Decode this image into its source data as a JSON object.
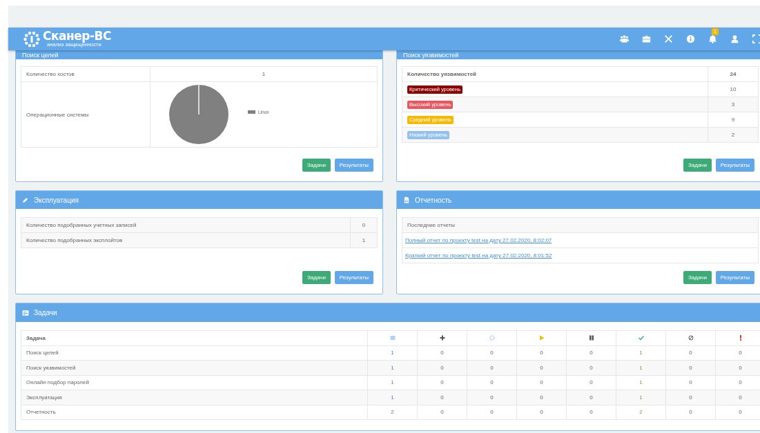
{
  "header": {
    "logo_title": "Сканер-ВС",
    "logo_subtitle": "анализ защищенности",
    "notification_count": "1"
  },
  "target_search": {
    "title": "Поиск целей",
    "rows": [
      {
        "label": "Количество хостов",
        "value": "1"
      }
    ],
    "os_label": "Операционные системы",
    "legend": [
      {
        "label": "Linux",
        "color": "#808080"
      }
    ],
    "buttons": [
      {
        "label": "Задачи",
        "kind": "success"
      },
      {
        "label": "Результаты",
        "kind": "info"
      }
    ]
  },
  "vulnerabilities": {
    "title": "Поиск уязвимостей",
    "total_label": "Количество уязвимостей",
    "total": "24",
    "levels": [
      {
        "label": "Критический уровень",
        "color": "#8b0000",
        "count": "10"
      },
      {
        "label": "Высокий уровень",
        "color": "#e8565e",
        "count": "3"
      },
      {
        "label": "Средний уровень",
        "color": "#f7b900",
        "count": "9"
      },
      {
        "label": "Низкий уровень",
        "color": "#94c0ef",
        "count": "2"
      }
    ],
    "buttons": [
      {
        "label": "Задачи",
        "kind": "success"
      },
      {
        "label": "Результаты",
        "kind": "info"
      }
    ]
  },
  "exploitation": {
    "title": "Эксплуатация",
    "rows": [
      {
        "label": "Количество подобранных учетных записей",
        "value": "0"
      },
      {
        "label": "Количество подобранных эксплойтов",
        "value": "1"
      }
    ],
    "buttons": [
      {
        "label": "Задачи",
        "kind": "success"
      },
      {
        "label": "Результаты",
        "kind": "info"
      }
    ]
  },
  "reports": {
    "title": "Отчетность",
    "heading": "Последние отчеты",
    "links": [
      "Полный отчет по проекту test на дату 27.02.2020, 8:02:07",
      "Краткий отчет по проекту test на дату 27.02.2020, 8:01:52"
    ],
    "buttons": [
      {
        "label": "Задачи",
        "kind": "success"
      },
      {
        "label": "Результаты",
        "kind": "info"
      }
    ]
  },
  "tasks": {
    "title": "Задачи",
    "first_column": "Задача",
    "columns": [
      {
        "kind": "total"
      },
      {
        "kind": "new"
      },
      {
        "kind": "waiting"
      },
      {
        "kind": "running"
      },
      {
        "kind": "paused"
      },
      {
        "kind": "done"
      },
      {
        "kind": "cancelled"
      },
      {
        "kind": "error"
      }
    ],
    "rows": [
      {
        "name": "Поиск целей",
        "values": [
          "1",
          "0",
          "0",
          "0",
          "0",
          "1",
          "0",
          "0"
        ]
      },
      {
        "name": "Поиск уязвимостей",
        "values": [
          "1",
          "0",
          "0",
          "0",
          "0",
          "1",
          "0",
          "0"
        ]
      },
      {
        "name": "Онлайн подбор паролей",
        "values": [
          "1",
          "0",
          "0",
          "0",
          "0",
          "1",
          "0",
          "0"
        ]
      },
      {
        "name": "Эксплуатация",
        "values": [
          "1",
          "0",
          "0",
          "0",
          "0",
          "1",
          "0",
          "0"
        ]
      },
      {
        "name": "Отчетность",
        "values": [
          "2",
          "0",
          "0",
          "0",
          "0",
          "2",
          "0",
          "0"
        ]
      }
    ]
  }
}
